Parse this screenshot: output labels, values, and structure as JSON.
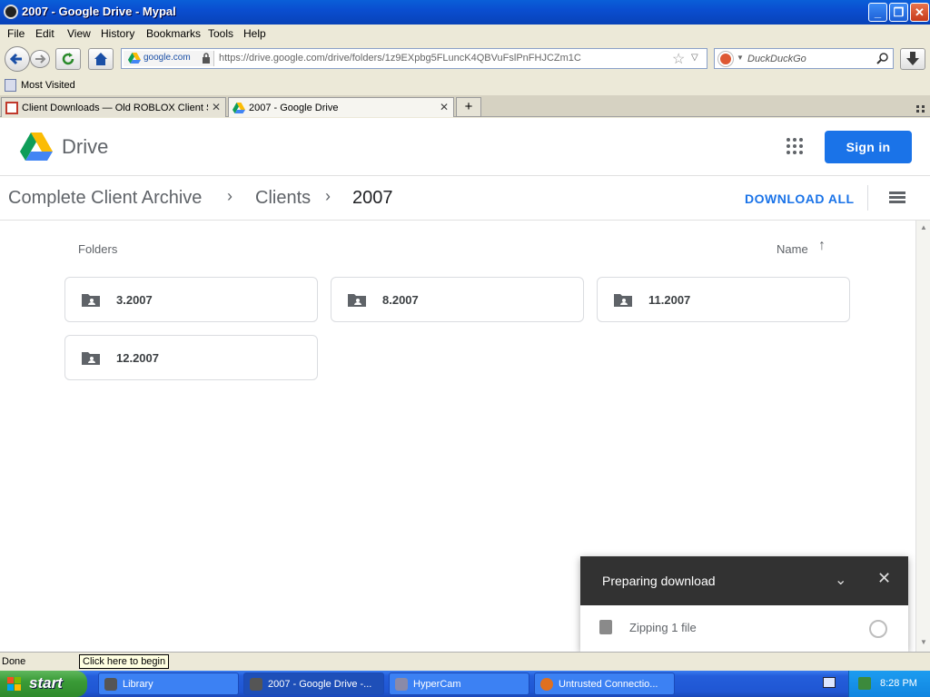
{
  "window": {
    "title": "2007 - Google Drive - Mypal"
  },
  "menu": [
    "File",
    "Edit",
    "View",
    "History",
    "Bookmarks",
    "Tools",
    "Help"
  ],
  "nav": {
    "site_identity": "google.com",
    "url": "https://drive.google.com/drive/folders/1z9EXpbg5FLuncK4QBVuFslPnFHJCZm1C",
    "search_placeholder": "DuckDuckGo"
  },
  "bookmarks": {
    "most_visited": "Most Visited"
  },
  "tabs": [
    {
      "label": "Client Downloads — Old ROBLOX Client S...",
      "active": false
    },
    {
      "label": "2007 - Google Drive",
      "active": true
    }
  ],
  "drive": {
    "brand": "Drive",
    "signin": "Sign in",
    "breadcrumb": [
      "Complete Client Archive",
      "Clients",
      "2007"
    ],
    "download_all": "DOWNLOAD ALL",
    "folders_heading": "Folders",
    "sort_label": "Name",
    "folders": [
      "3.2007",
      "8.2007",
      "11.2007",
      "12.2007"
    ]
  },
  "toast": {
    "title": "Preparing download",
    "item": "Zipping 1 file"
  },
  "status": {
    "text": "Done",
    "tooltip": "Click here to begin"
  },
  "taskbar": {
    "start": "start",
    "tasks": [
      "Library",
      "2007 - Google Drive -...",
      "HyperCam",
      "Untrusted Connectio..."
    ],
    "clock": "8:28 PM"
  }
}
